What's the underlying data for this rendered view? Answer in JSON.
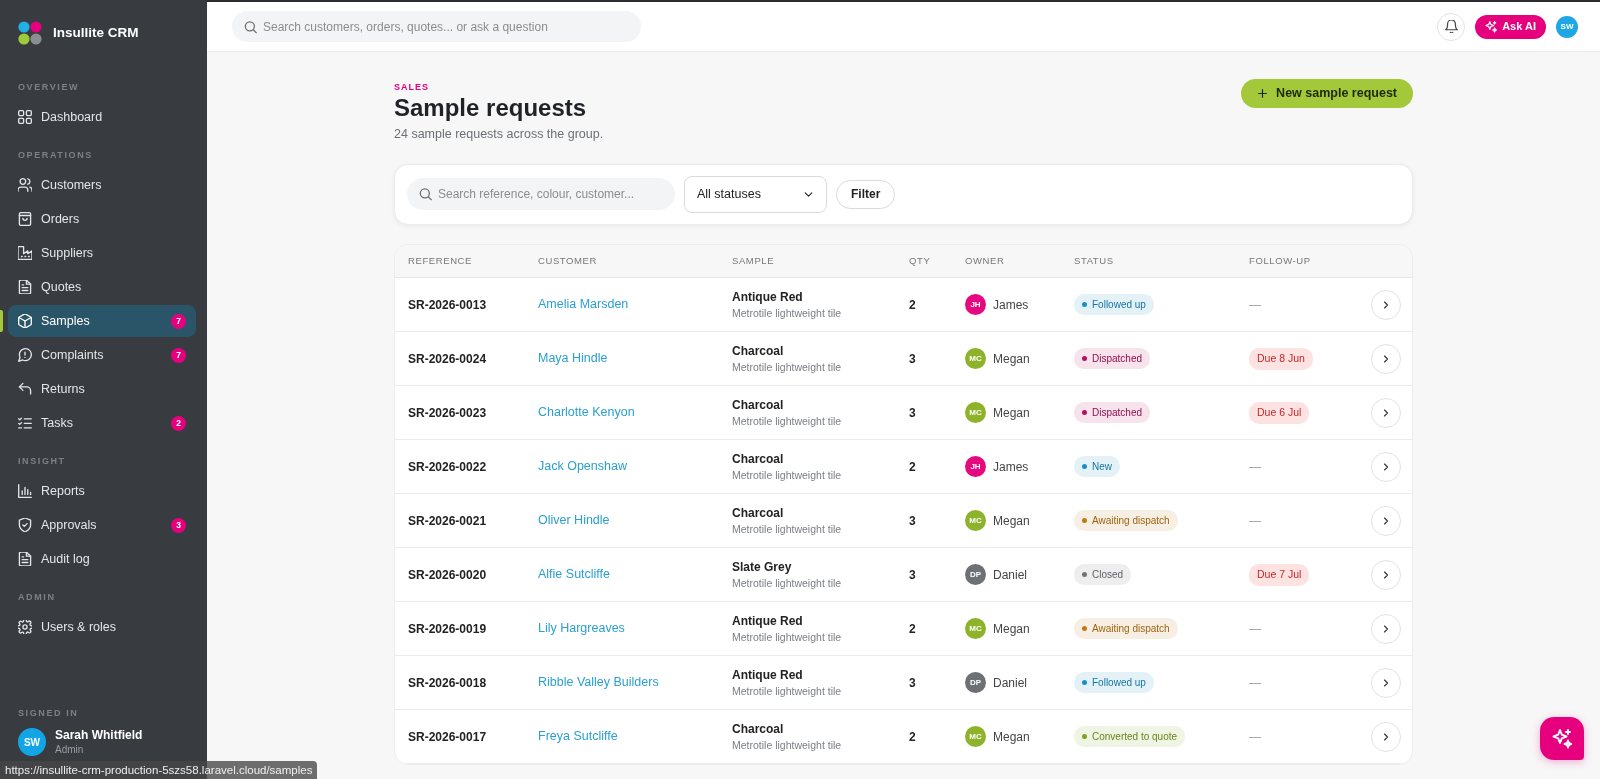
{
  "sidebar": {
    "brand": "Insullite CRM",
    "sections": [
      {
        "heading": "OVERVIEW",
        "items": [
          {
            "label": "Dashboard",
            "selected": false
          }
        ]
      },
      {
        "heading": "OPERATIONS",
        "items": [
          {
            "label": "Customers",
            "selected": false
          },
          {
            "label": "Orders",
            "selected": false
          },
          {
            "label": "Suppliers",
            "selected": false
          },
          {
            "label": "Quotes",
            "selected": false
          },
          {
            "label": "Samples",
            "selected": true,
            "badge": "7"
          },
          {
            "label": "Complaints",
            "selected": false,
            "badge": "7"
          },
          {
            "label": "Returns",
            "selected": false
          },
          {
            "label": "Tasks",
            "selected": false,
            "badge": "2"
          }
        ]
      },
      {
        "heading": "INSIGHT",
        "items": [
          {
            "label": "Reports",
            "selected": false
          },
          {
            "label": "Approvals",
            "selected": false,
            "badge": "3"
          },
          {
            "label": "Audit log",
            "selected": false
          }
        ]
      },
      {
        "heading": "ADMIN",
        "items": [
          {
            "label": "Users & roles",
            "selected": false
          }
        ]
      }
    ],
    "signed_in": {
      "heading": "SIGNED IN",
      "initials": "SW",
      "name": "Sarah Whitfield",
      "role": "Admin"
    }
  },
  "topbar": {
    "search": {
      "placeholder": "Search customers, orders, quotes... or ask a question"
    },
    "ask_ai": "Ask AI",
    "avatar_initials": "SW"
  },
  "page": {
    "eyebrow": "SALES",
    "title": "Sample requests",
    "subtitle": "24 sample requests across the group.",
    "new_button": "New sample request"
  },
  "filters": {
    "search": {
      "placeholder": "Search reference, colour, customer..."
    },
    "status_select": "All statuses",
    "filter_button": "Filter"
  },
  "table": {
    "columns": [
      "REFERENCE",
      "CUSTOMER",
      "SAMPLE",
      "QTY",
      "OWNER",
      "STATUS",
      "FOLLOW-UP"
    ],
    "rows": [
      {
        "reference": "SR-2026-0013",
        "customer": "Amelia Marsden",
        "sample": {
          "name": "Antique Red",
          "product": "Metrotile lightweight tile"
        },
        "qty": "2",
        "owner": {
          "initials": "JH",
          "name": "James",
          "color": "#e5097f"
        },
        "status": {
          "label": "Followed up",
          "color": "#1a8fc7"
        },
        "follow_up": {
          "kind": "none",
          "text": "—"
        }
      },
      {
        "reference": "SR-2026-0024",
        "customer": "Maya Hindle",
        "sample": {
          "name": "Charcoal",
          "product": "Metrotile lightweight tile"
        },
        "qty": "3",
        "owner": {
          "initials": "MC",
          "name": "Megan",
          "color": "#8db32b"
        },
        "status": {
          "label": "Dispatched",
          "color": "#b0125f"
        },
        "follow_up": {
          "kind": "due",
          "text": "Due 8 Jun"
        }
      },
      {
        "reference": "SR-2026-0023",
        "customer": "Charlotte Kenyon",
        "sample": {
          "name": "Charcoal",
          "product": "Metrotile lightweight tile"
        },
        "qty": "3",
        "owner": {
          "initials": "MC",
          "name": "Megan",
          "color": "#8db32b"
        },
        "status": {
          "label": "Dispatched",
          "color": "#b0125f"
        },
        "follow_up": {
          "kind": "due",
          "text": "Due 6 Jul"
        }
      },
      {
        "reference": "SR-2026-0022",
        "customer": "Jack Openshaw",
        "sample": {
          "name": "Charcoal",
          "product": "Metrotile lightweight tile"
        },
        "qty": "2",
        "owner": {
          "initials": "JH",
          "name": "James",
          "color": "#e5097f"
        },
        "status": {
          "label": "New",
          "color": "#1a8fc7"
        },
        "follow_up": {
          "kind": "none",
          "text": "—"
        }
      },
      {
        "reference": "SR-2026-0021",
        "customer": "Oliver Hindle",
        "sample": {
          "name": "Charcoal",
          "product": "Metrotile lightweight tile"
        },
        "qty": "3",
        "owner": {
          "initials": "MC",
          "name": "Megan",
          "color": "#8db32b"
        },
        "status": {
          "label": "Awaiting dispatch",
          "color": "#c07a12"
        },
        "follow_up": {
          "kind": "none",
          "text": "—"
        }
      },
      {
        "reference": "SR-2026-0020",
        "customer": "Alfie Sutcliffe",
        "sample": {
          "name": "Slate Grey",
          "product": "Metrotile lightweight tile"
        },
        "qty": "3",
        "owner": {
          "initials": "DP",
          "name": "Daniel",
          "color": "#6d7175"
        },
        "status": {
          "label": "Closed",
          "color": "#70747a"
        },
        "follow_up": {
          "kind": "due",
          "text": "Due 7 Jul"
        }
      },
      {
        "reference": "SR-2026-0019",
        "customer": "Lily Hargreaves",
        "sample": {
          "name": "Antique Red",
          "product": "Metrotile lightweight tile"
        },
        "qty": "2",
        "owner": {
          "initials": "MC",
          "name": "Megan",
          "color": "#8db32b"
        },
        "status": {
          "label": "Awaiting dispatch",
          "color": "#c07a12"
        },
        "follow_up": {
          "kind": "none",
          "text": "—"
        }
      },
      {
        "reference": "SR-2026-0018",
        "customer": "Ribble Valley Builders",
        "sample": {
          "name": "Antique Red",
          "product": "Metrotile lightweight tile"
        },
        "qty": "3",
        "owner": {
          "initials": "DP",
          "name": "Daniel",
          "color": "#6d7175"
        },
        "status": {
          "label": "Followed up",
          "color": "#1a8fc7"
        },
        "follow_up": {
          "kind": "none",
          "text": "—"
        }
      },
      {
        "reference": "SR-2026-0017",
        "customer": "Freya Sutcliffe",
        "sample": {
          "name": "Charcoal",
          "product": "Metrotile lightweight tile"
        },
        "qty": "2",
        "owner": {
          "initials": "MC",
          "name": "Megan",
          "color": "#8db32b"
        },
        "status": {
          "label": "Converted to quote",
          "color": "#7aa51c"
        },
        "follow_up": {
          "kind": "none",
          "text": "—"
        }
      }
    ]
  },
  "status_bar": {
    "url": "https://insullite-crm-production-5szs58.laravel.cloud/samples"
  }
}
